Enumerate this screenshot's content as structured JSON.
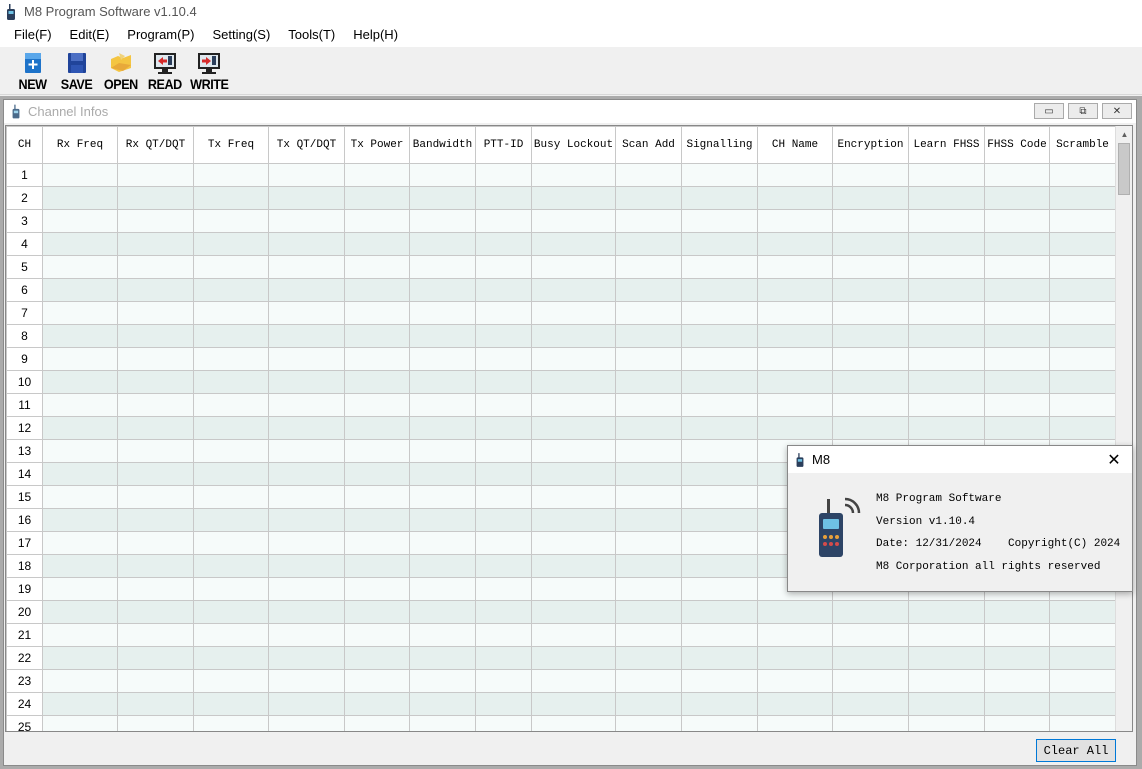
{
  "window": {
    "title": "M8 Program Software v1.10.4"
  },
  "menu": [
    "File(F)",
    "Edit(E)",
    "Program(P)",
    "Setting(S)",
    "Tools(T)",
    "Help(H)"
  ],
  "toolbar": {
    "new": "NEW",
    "save": "SAVE",
    "open": "OPEN",
    "read": "READ",
    "write": "WRITE"
  },
  "child_window": {
    "title": "Channel Infos"
  },
  "table": {
    "columns": [
      "CH",
      "Rx Freq",
      "Rx QT/DQT",
      "Tx Freq",
      "Tx QT/DQT",
      "Tx Power",
      "Bandwidth",
      "PTT-ID",
      "Busy Lockout",
      "Scan Add",
      "Signalling",
      "CH Name",
      "Encryption",
      "Learn FHSS",
      "FHSS Code",
      "Scramble"
    ],
    "rows": [
      "1",
      "2",
      "3",
      "4",
      "5",
      "6",
      "7",
      "8",
      "9",
      "10",
      "11",
      "12",
      "13",
      "14",
      "15",
      "16",
      "17",
      "18",
      "19",
      "20",
      "21",
      "22",
      "23",
      "24",
      "25"
    ]
  },
  "footer": {
    "clear_all": "Clear All"
  },
  "about_dialog": {
    "title": "M8",
    "product": "M8 Program Software",
    "version": "Version v1.10.4",
    "date": "Date: 12/31/2024",
    "copyright": "Copyright(C) 2024",
    "rights": "M8 Corporation all rights reserved"
  },
  "colors": {
    "row_odd": "#e6f0ee",
    "row_even": "#f6fbfa",
    "mdi_background": "#ababab",
    "button_focus": "#0078d7"
  },
  "icons": [
    "radio-icon",
    "new-file-icon",
    "save-disk-icon",
    "open-folder-icon",
    "read-radio-icon",
    "write-radio-icon",
    "close-icon",
    "minimize-icon",
    "restore-icon"
  ]
}
